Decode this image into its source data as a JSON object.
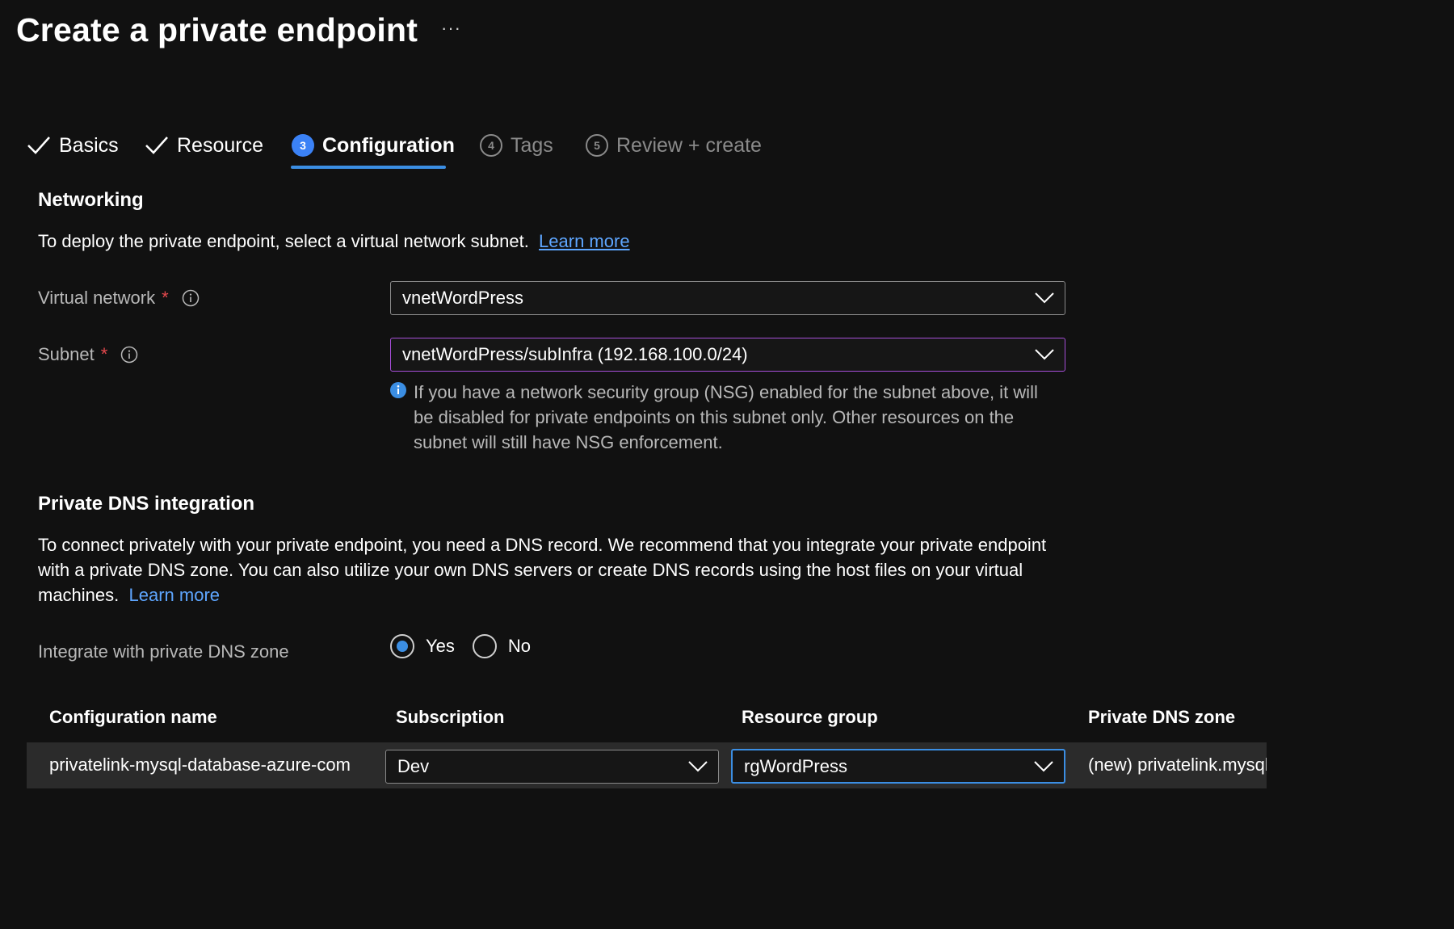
{
  "header": {
    "title": "Create a private endpoint",
    "more": "···"
  },
  "tabs": [
    {
      "label": "Basics",
      "state": "done"
    },
    {
      "label": "Resource",
      "state": "done"
    },
    {
      "label": "Configuration",
      "number": "3",
      "state": "active"
    },
    {
      "label": "Tags",
      "number": "4",
      "state": "disabled"
    },
    {
      "label": "Review + create",
      "number": "5",
      "state": "disabled"
    }
  ],
  "networking": {
    "title": "Networking",
    "description": "To deploy the private endpoint, select a virtual network subnet.",
    "learn_more": "Learn more",
    "virtual_network": {
      "label": "Virtual network",
      "required": "*",
      "value": "vnetWordPress"
    },
    "subnet": {
      "label": "Subnet",
      "required": "*",
      "value": "vnetWordPress/subInfra (192.168.100.0/24)"
    },
    "nsg_note": "If you have a network security group (NSG) enabled for the subnet above, it will be disabled for private endpoints on this subnet only. Other resources on the subnet will still have NSG enforcement."
  },
  "dns": {
    "title": "Private DNS integration",
    "description": "To connect privately with your private endpoint, you need a DNS record. We recommend that you integrate your private endpoint with a private DNS zone. You can also utilize your own DNS servers or create DNS records using the host files on your virtual machines.",
    "learn_more": "Learn more",
    "integrate_label": "Integrate with private DNS zone",
    "options": {
      "yes": "Yes",
      "no": "No"
    },
    "selected": "Yes"
  },
  "table": {
    "headers": [
      "Configuration name",
      "Subscription",
      "Resource group",
      "Private DNS zone"
    ],
    "row": {
      "configuration_name": "privatelink-mysql-database-azure-com",
      "subscription": "Dev",
      "resource_group": "rgWordPress",
      "private_dns_zone": "(new) privatelink.mysql.database.azure.com"
    }
  },
  "colors": {
    "accent": "#3b8ee3",
    "link": "#5ea6ff",
    "required": "#e5484d",
    "background": "#111111"
  }
}
